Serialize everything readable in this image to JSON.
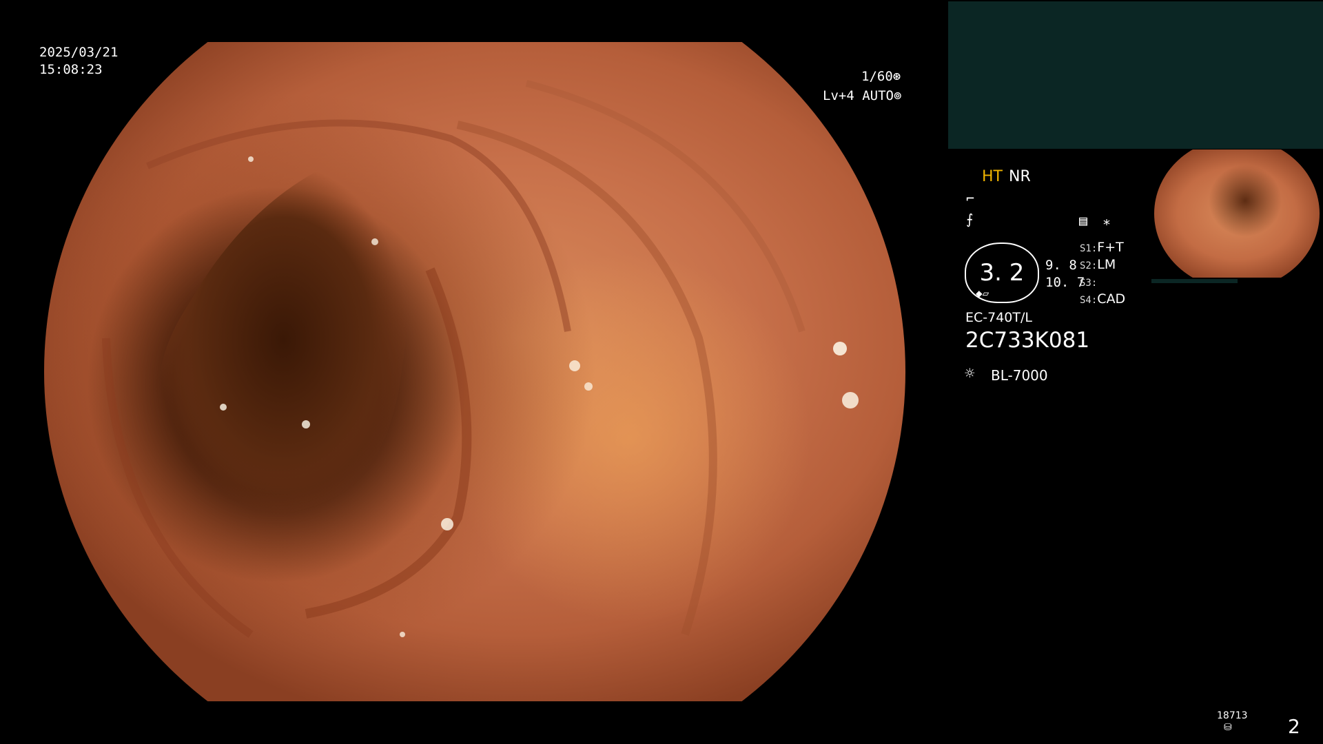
{
  "overlay": {
    "date": "2025/03/21",
    "time": "15:08:23",
    "shutter": "1/60",
    "shutter_icon": "⊛",
    "exposure": "Lv+4 AUTO",
    "exposure_icon": "⊚"
  },
  "panel": {
    "ht_label": "HT",
    "nr_label": "NR",
    "icon_a": "⌐",
    "icon_b": "⨍",
    "list_icon": "▤",
    "star_icon": "∗",
    "zoom_value": "3. 2",
    "value_1": "9. 8",
    "value_2": "10. 7",
    "slots": [
      {
        "key": "S1:",
        "value": "F+T"
      },
      {
        "key": "S2:",
        "value": "LM"
      },
      {
        "key": "S3:",
        "value": ""
      },
      {
        "key": "S4:",
        "value": "CAD"
      }
    ],
    "scope_model": "EC-740T/L",
    "scope_serial": "2C733K081",
    "light_source": "BL-7000"
  },
  "footer": {
    "counter": "18713",
    "page": "2"
  },
  "colors": {
    "ht_accent": "#f0b400",
    "panel_dark": "#0b2624",
    "background": "#000000"
  }
}
